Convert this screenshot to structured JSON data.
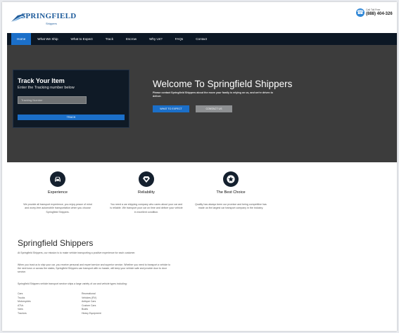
{
  "header": {
    "logo_text": "SPRINGFIELD",
    "logo_sub": "Shippers",
    "phone_label": "Call Toll Free",
    "phone_number": "(888) 404-326"
  },
  "nav": {
    "items": [
      "Home",
      "What We Ship",
      "What to Expect",
      "Track",
      "Escrow",
      "Why Us?",
      "FAQs",
      "Contact"
    ]
  },
  "track": {
    "title": "Track Your Item",
    "subtitle": "Enter the Tracking number below",
    "placeholder": "Tracking Number",
    "button": "TRACK"
  },
  "welcome": {
    "title": "Welcome To Springfield Shippers",
    "text": "Please contact Springfield Shippers about the move your family is relying on us, and we're driven to deliver.",
    "button_expect": "WHAT TO EXPECT",
    "button_contact": "CONTACT US"
  },
  "features": [
    {
      "icon": "car-icon",
      "title": "Experience",
      "text": "We provide all transport experience, you enjoy peace of mind and worry-free automobile transportation when you choose Springfield Shippers."
    },
    {
      "icon": "heart-diamond-icon",
      "title": "Reliability",
      "text": "You need a car shipping company who cares about your car and is reliable. We transport your car on time and deliver your vehicle in excellent condition."
    },
    {
      "icon": "star-icon",
      "title": "The Best Choice",
      "text": "Quality has always been our promise and being competitive has made us the largest car transport company in the industry."
    }
  ],
  "about": {
    "title": "Springfield Shippers",
    "p1": "At Springfield Shippers, our mission is to make vehicle transporting a positive experience for each customer.",
    "p2": "When you trust us to ship your car, you receive personal and expert service and superior service. Whether you need to transport a vehicle to the next town or across the states, Springfield Shippers can transport with no hassle, will keep your vehicle safe and provide door to door service.",
    "p3": "Springfield Shippers vehicle transport service ships a large variety of car and vehicle types including:"
  },
  "vehicle_types": {
    "left": [
      "Cars",
      "Trucks",
      "Motorcycles",
      "ATVs",
      "Vans",
      "Tractors"
    ],
    "right": [
      "Recreational",
      "Vehicles (RV)",
      "Antique Cars",
      "Custom Cars",
      "Boats",
      "Heavy Equipment"
    ]
  },
  "colors": {
    "nav_bg": "#0c1724",
    "accent": "#1b6fc9",
    "hero_bg": "#3c3c3c",
    "track_bg": "#0f1a26",
    "logo_blue": "#1f5c9b"
  }
}
